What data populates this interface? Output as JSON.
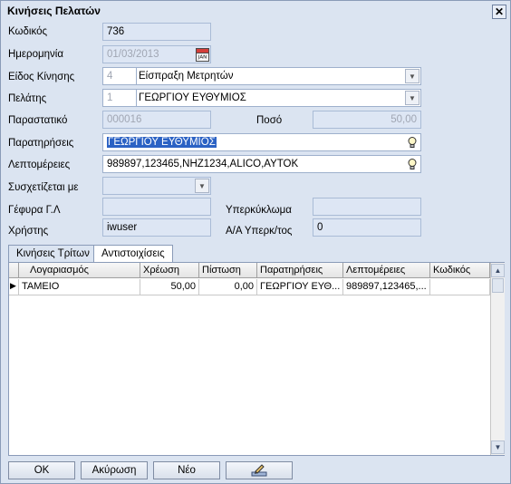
{
  "window": {
    "title": "Κινήσεις Πελατών",
    "close_symbol": "✕"
  },
  "form": {
    "code": {
      "label": "Κωδικός",
      "value": "736"
    },
    "date": {
      "label": "Ημερομηνία",
      "value": "01/03/2013",
      "calendar_icon": "calendar-icon",
      "calendar_text": "JAN"
    },
    "movement_type": {
      "label": "Είδος Κίνησης",
      "code": "4",
      "value": "Είσπραξη Μετρητών"
    },
    "customer": {
      "label": "Πελάτης",
      "code": "1",
      "value": "ΓΕΩΡΓΙΟΥ ΕΥΘΥΜΙΟΣ"
    },
    "document": {
      "label": "Παραστατικό",
      "value": "000016"
    },
    "amount": {
      "label": "Ποσό",
      "value": "50,00"
    },
    "remarks": {
      "label": "Παρατηρήσεις",
      "value": "ΓΕΩΡΓΙΟΥ ΕΥΘΥΜΙΟΣ"
    },
    "details": {
      "label": "Λεπτομέρειες",
      "value": "989897,123465,NHZ1234,ALICO,ΑΥΤΟΚ"
    },
    "related": {
      "label": "Συσχετίζεται με",
      "value": ""
    },
    "gl_bridge": {
      "label": "Γέφυρα Γ.Λ",
      "value": ""
    },
    "overdraft": {
      "label": "Υπερκύκλωμα",
      "value": ""
    },
    "user": {
      "label": "Χρήστης",
      "value": "iwuser"
    },
    "overdraft_seq": {
      "label": "Α/Α Υπερκ/τος",
      "value": "0"
    }
  },
  "tabs": [
    {
      "label": "Κινήσεις Τρίτων",
      "active": false
    },
    {
      "label": "Αντιστοιχίσεις",
      "active": true
    }
  ],
  "grid": {
    "columns": [
      "Λογαριασμός",
      "Χρέωση",
      "Πίστωση",
      "Παρατηρήσεις",
      "Λεπτομέρειες",
      "Κωδικός"
    ],
    "rows": [
      {
        "marker": "▶",
        "cells": [
          "ΤΑΜΕΙΟ",
          "50,00",
          "0,00",
          "ΓΕΩΡΓΙΟΥ ΕΥΘ...",
          "989897,123465,...",
          ""
        ]
      }
    ]
  },
  "buttons": {
    "ok": "OK",
    "cancel": "Ακύρωση",
    "new": "Νέο",
    "edit_icon": "edit-pencil-icon"
  },
  "colors": {
    "window_bg": "#dbe4f1",
    "selection": "#2b62c4",
    "readonly_field": "#dde6f4"
  }
}
